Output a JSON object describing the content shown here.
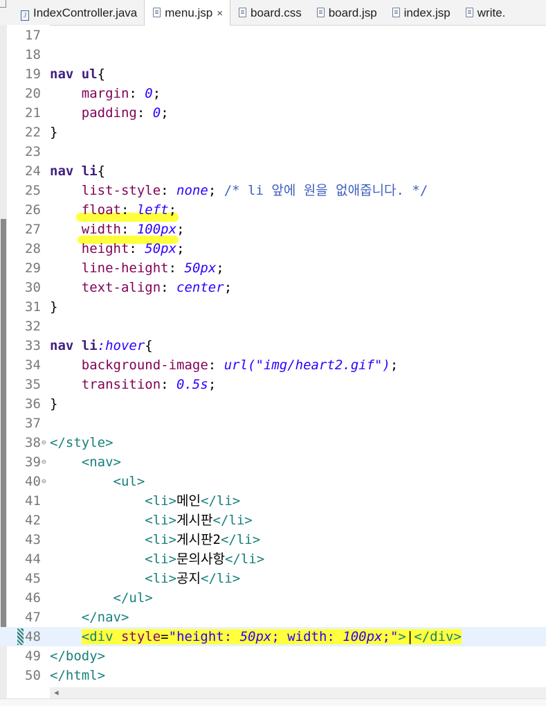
{
  "tabs": [
    {
      "label": "IndexController.java",
      "icon": "java-file-icon"
    },
    {
      "label": "menu.jsp",
      "icon": "jsp-file-icon",
      "active": true
    },
    {
      "label": "board.css",
      "icon": "css-file-icon"
    },
    {
      "label": "board.jsp",
      "icon": "jsp-file-icon"
    },
    {
      "label": "index.jsp",
      "icon": "jsp-file-icon"
    },
    {
      "label": "write.",
      "icon": "jsp-file-icon"
    }
  ],
  "close_glyph": "×",
  "lines": [
    {
      "n": "17",
      "t": [],
      "p": [
        ""
      ]
    },
    {
      "n": "18",
      "t": [],
      "p": [
        ""
      ]
    },
    {
      "n": "19",
      "t": [
        "sel",
        "plain"
      ],
      "p": [
        "nav ul",
        "{"
      ]
    },
    {
      "n": "20",
      "t": [
        "plain",
        "prop",
        "plain",
        "val",
        "plain"
      ],
      "p": [
        "    ",
        "margin",
        ": ",
        "0",
        ";"
      ]
    },
    {
      "n": "21",
      "t": [
        "plain",
        "prop",
        "plain",
        "val",
        "plain"
      ],
      "p": [
        "    ",
        "padding",
        ": ",
        "0",
        ";"
      ]
    },
    {
      "n": "22",
      "t": [
        "plain"
      ],
      "p": [
        "}"
      ]
    },
    {
      "n": "23",
      "t": [],
      "p": [
        ""
      ]
    },
    {
      "n": "24",
      "t": [
        "sel",
        "plain"
      ],
      "p": [
        "nav li",
        "{"
      ]
    },
    {
      "n": "25",
      "t": [
        "plain",
        "prop",
        "plain",
        "val",
        "plain",
        "cm"
      ],
      "p": [
        "    ",
        "list-style",
        ": ",
        "none",
        "; ",
        "/* li 앞에 원을 없애줍니다. */"
      ]
    },
    {
      "n": "26",
      "t": [
        "plain",
        "prop",
        "plain",
        "val",
        "plain"
      ],
      "p": [
        "    ",
        "float",
        ": ",
        "left",
        ";"
      ]
    },
    {
      "n": "27",
      "t": [
        "plain",
        "prop",
        "plain",
        "val",
        "plain"
      ],
      "p": [
        "    ",
        "width",
        ": ",
        "100px",
        ";"
      ]
    },
    {
      "n": "28",
      "t": [
        "plain",
        "prop",
        "plain",
        "val",
        "plain"
      ],
      "p": [
        "    ",
        "height",
        ": ",
        "50px",
        ";"
      ]
    },
    {
      "n": "29",
      "t": [
        "plain",
        "prop",
        "plain",
        "val",
        "plain"
      ],
      "p": [
        "    ",
        "line-height",
        ": ",
        "50px",
        ";"
      ]
    },
    {
      "n": "30",
      "t": [
        "plain",
        "prop",
        "plain",
        "val",
        "plain"
      ],
      "p": [
        "    ",
        "text-align",
        ": ",
        "center",
        ";"
      ]
    },
    {
      "n": "31",
      "t": [
        "plain"
      ],
      "p": [
        "}"
      ]
    },
    {
      "n": "32",
      "t": [],
      "p": [
        ""
      ]
    },
    {
      "n": "33",
      "t": [
        "sel",
        "val",
        "plain"
      ],
      "p": [
        "nav li",
        ":hover",
        "{"
      ]
    },
    {
      "n": "34",
      "t": [
        "plain",
        "prop",
        "plain",
        "val",
        "plain"
      ],
      "p": [
        "    ",
        "background-image",
        ": ",
        "url(\"img/heart2.gif\")",
        ";"
      ]
    },
    {
      "n": "35",
      "t": [
        "plain",
        "prop",
        "plain",
        "val",
        "plain"
      ],
      "p": [
        "    ",
        "transition",
        ": ",
        "0.5s",
        ";"
      ]
    },
    {
      "n": "36",
      "t": [
        "plain"
      ],
      "p": [
        "}"
      ]
    },
    {
      "n": "37",
      "t": [],
      "p": [
        ""
      ]
    },
    {
      "n": "38",
      "fold": true,
      "t": [
        "tag"
      ],
      "p": [
        "</style>"
      ]
    },
    {
      "n": "39",
      "fold": true,
      "t": [
        "plain",
        "tag"
      ],
      "p": [
        "    ",
        "<nav>"
      ]
    },
    {
      "n": "40",
      "fold": true,
      "t": [
        "plain",
        "tag"
      ],
      "p": [
        "        ",
        "<ul>"
      ]
    },
    {
      "n": "41",
      "t": [
        "plain",
        "tag",
        "plain",
        "tag"
      ],
      "p": [
        "            ",
        "<li>",
        "메인",
        "</li>"
      ]
    },
    {
      "n": "42",
      "t": [
        "plain",
        "tag",
        "plain",
        "tag"
      ],
      "p": [
        "            ",
        "<li>",
        "게시판",
        "</li>"
      ]
    },
    {
      "n": "43",
      "t": [
        "plain",
        "tag",
        "plain",
        "tag"
      ],
      "p": [
        "            ",
        "<li>",
        "게시판2",
        "</li>"
      ]
    },
    {
      "n": "44",
      "t": [
        "plain",
        "tag",
        "plain",
        "tag"
      ],
      "p": [
        "            ",
        "<li>",
        "문의사항",
        "</li>"
      ]
    },
    {
      "n": "45",
      "t": [
        "plain",
        "tag",
        "plain",
        "tag"
      ],
      "p": [
        "            ",
        "<li>",
        "공지",
        "</li>"
      ]
    },
    {
      "n": "46",
      "t": [
        "plain",
        "tag"
      ],
      "p": [
        "        ",
        "</ul>"
      ]
    },
    {
      "n": "47",
      "t": [
        "plain",
        "tag"
      ],
      "p": [
        "    ",
        "</nav>"
      ]
    },
    {
      "n": "48",
      "current": true,
      "t": [
        "plain",
        "tag hl",
        "attr hl",
        "plain hl",
        "str hl",
        "val hl",
        "str hl",
        "val hl",
        "str hl",
        "tag hl",
        "plain hl",
        "tag hl"
      ],
      "p": [
        "    ",
        "<div ",
        "style",
        "=",
        "\"height: ",
        "50px",
        "; width: ",
        "100px",
        ";\"",
        ">",
        "|",
        "</div>"
      ]
    },
    {
      "n": "49",
      "t": [
        "tag"
      ],
      "p": [
        "</body>"
      ]
    },
    {
      "n": "50",
      "t": [
        "tag"
      ],
      "p": [
        "</html>"
      ]
    }
  ],
  "colors": {
    "selector": "#3f1f7f",
    "property": "#7f0055",
    "value": "#2a00ff",
    "comment": "#3f5fbf",
    "tag": "#17807a",
    "highlight": "#ffff3c",
    "current_line": "#e8f2fe"
  }
}
